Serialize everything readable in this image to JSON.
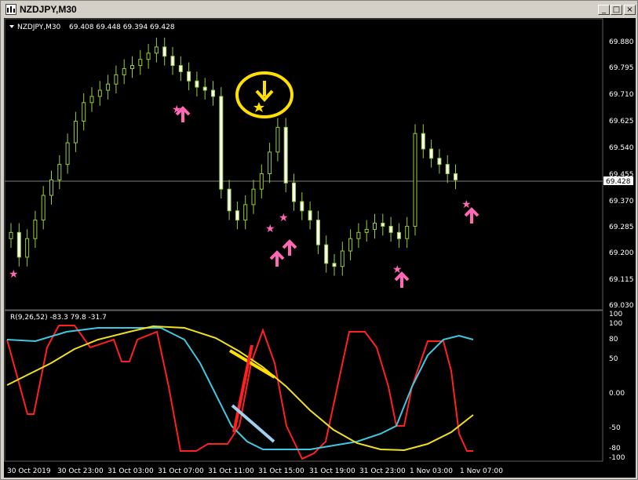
{
  "window": {
    "title": "NZDJPY,M30",
    "minimize_glyph": "_",
    "maximize_glyph": "□",
    "close_glyph": "×"
  },
  "price_panel": {
    "header_symbol": "NZDJPY,M30",
    "header_ohlc": "69.408 69.448 69.394 69.428",
    "current_price": "69.428",
    "y_ticks": [
      "69.880",
      "69.795",
      "69.710",
      "69.625",
      "69.540",
      "69.455",
      "69.370",
      "69.285",
      "69.200",
      "69.115",
      "69.030"
    ]
  },
  "oscillator_panel": {
    "header": "R(9,26,52) -83.3 79.8 -31.7",
    "y_ticks": [
      "100",
      "80",
      "50",
      "0.00",
      "-50",
      "-80",
      "-100"
    ]
  },
  "x_axis_ticks": [
    "30 Oct 2019",
    "30 Oct 23:00",
    "31 Oct 03:00",
    "31 Oct 07:00",
    "31 Oct 11:00",
    "31 Oct 15:00",
    "31 Oct 19:00",
    "31 Oct 23:00",
    "1 Nov 03:00",
    "1 Nov 07:00"
  ],
  "colors": {
    "background": "#000000",
    "candle": "#9acd32",
    "candle_body": "#ffffff",
    "grid": "#303030",
    "star": "#ff69b4",
    "arrow_pink": "#ff69b4",
    "arrow_yellow": "#ffff00",
    "line_red": "#ff2020",
    "line_cyan": "#40c8e0",
    "line_yellow": "#f0e020"
  },
  "chart_data": {
    "type": "candlestick",
    "price_close_approx": [
      69.26,
      69.18,
      69.24,
      69.3,
      69.38,
      69.43,
      69.48,
      69.55,
      69.62,
      69.68,
      69.7,
      69.72,
      69.74,
      69.77,
      69.79,
      69.8,
      69.82,
      69.84,
      69.86,
      69.83,
      69.8,
      69.78,
      69.75,
      69.73,
      69.72,
      69.7,
      69.4,
      69.33,
      69.3,
      69.35,
      69.4,
      69.45,
      69.52,
      69.6,
      69.42,
      69.36,
      69.33,
      69.3,
      69.22,
      69.16,
      69.15,
      69.2,
      69.24,
      69.26,
      69.27,
      69.29,
      69.28,
      69.26,
      69.24,
      69.28,
      69.58,
      69.53,
      69.5,
      69.48,
      69.45,
      69.43
    ],
    "oscillator_series": [
      {
        "name": "R(9)",
        "final": -83.3
      },
      {
        "name": "R(26)",
        "final": 79.8
      },
      {
        "name": "R(52)",
        "final": -31.7
      }
    ],
    "ylim_price": [
      69.03,
      69.88
    ],
    "ylim_osc": [
      -100,
      100
    ]
  }
}
